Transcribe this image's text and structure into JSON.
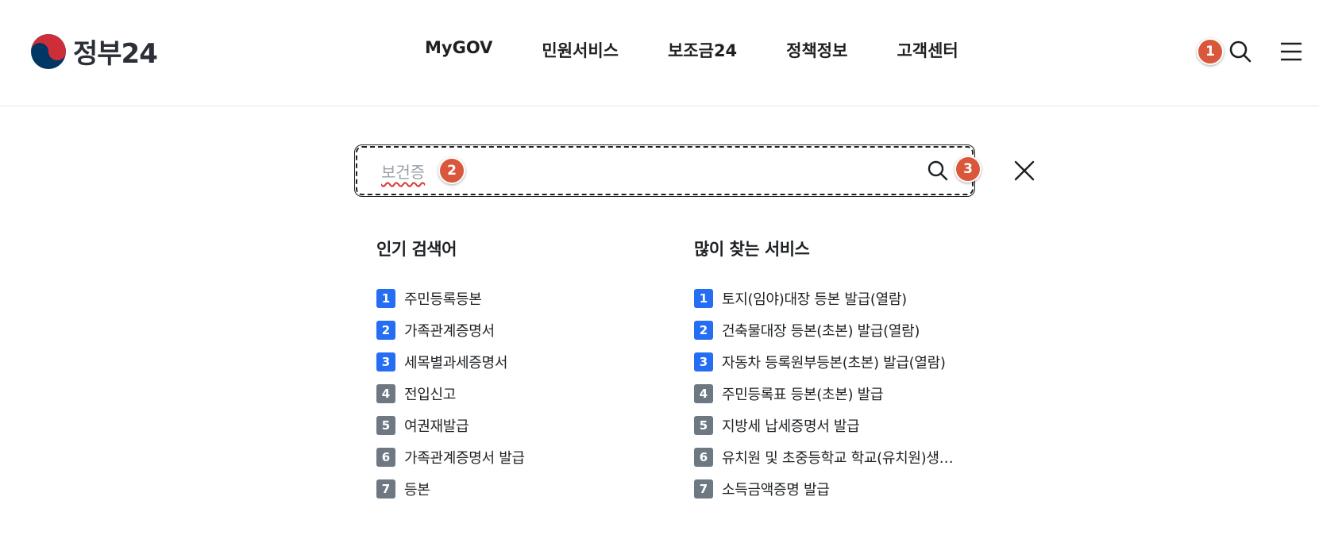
{
  "header": {
    "logo_text": "정부24",
    "nav": [
      "MyGOV",
      "민원서비스",
      "보조금24",
      "정책정보",
      "고객센터"
    ]
  },
  "markers": [
    "1",
    "2",
    "3"
  ],
  "search": {
    "typed_value": "보건증",
    "placeholder": ""
  },
  "popular": {
    "title": "인기 검색어",
    "items": [
      {
        "rank": "1",
        "label": "주민등록등본"
      },
      {
        "rank": "2",
        "label": "가족관계증명서"
      },
      {
        "rank": "3",
        "label": "세목별과세증명서"
      },
      {
        "rank": "4",
        "label": "전입신고"
      },
      {
        "rank": "5",
        "label": "여권재발급"
      },
      {
        "rank": "6",
        "label": "가족관계증명서 발급"
      },
      {
        "rank": "7",
        "label": "등본"
      }
    ]
  },
  "frequent": {
    "title": "많이 찾는 서비스",
    "items": [
      {
        "rank": "1",
        "label": "토지(임야)대장 등본 발급(열람)"
      },
      {
        "rank": "2",
        "label": "건축물대장 등본(초본) 발급(열람)"
      },
      {
        "rank": "3",
        "label": "자동차 등록원부등본(초본) 발급(열람)"
      },
      {
        "rank": "4",
        "label": "주민등록표 등본(초본) 발급"
      },
      {
        "rank": "5",
        "label": "지방세 납세증명서 발급"
      },
      {
        "rank": "6",
        "label": "유치원 및 초중등학교 학교(유치원)생…"
      },
      {
        "rank": "7",
        "label": "소득금액증명 발급"
      }
    ]
  },
  "colors": {
    "rank_top": "#256ef4",
    "rank_rest": "#6d7882",
    "marker": "#d9583c"
  },
  "icons": {
    "logo": "taegeuk-emblem-icon",
    "search": "search-icon",
    "menu": "hamburger-menu-icon",
    "close": "close-icon"
  }
}
